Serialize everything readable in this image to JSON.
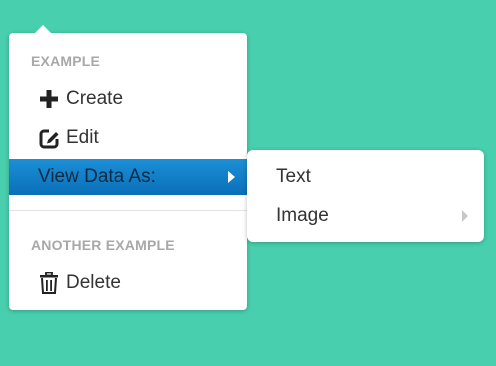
{
  "colors": {
    "background": "#48cfad",
    "active_item": "#0a6fb8",
    "section_header": "#a8a8a8",
    "text": "#333333"
  },
  "menu": {
    "section1_header": "EXAMPLE",
    "items": [
      {
        "label": "Create",
        "icon": "plus-icon"
      },
      {
        "label": "Edit",
        "icon": "edit-icon"
      },
      {
        "label": "View Data As:",
        "icon": "",
        "has_submenu": true,
        "active": true
      }
    ],
    "section2_header": "ANOTHER EXAMPLE",
    "items2": [
      {
        "label": "Delete",
        "icon": "trash-icon"
      }
    ]
  },
  "submenu": {
    "items": [
      {
        "label": "Text"
      },
      {
        "label": "Image",
        "has_submenu": true
      }
    ]
  }
}
